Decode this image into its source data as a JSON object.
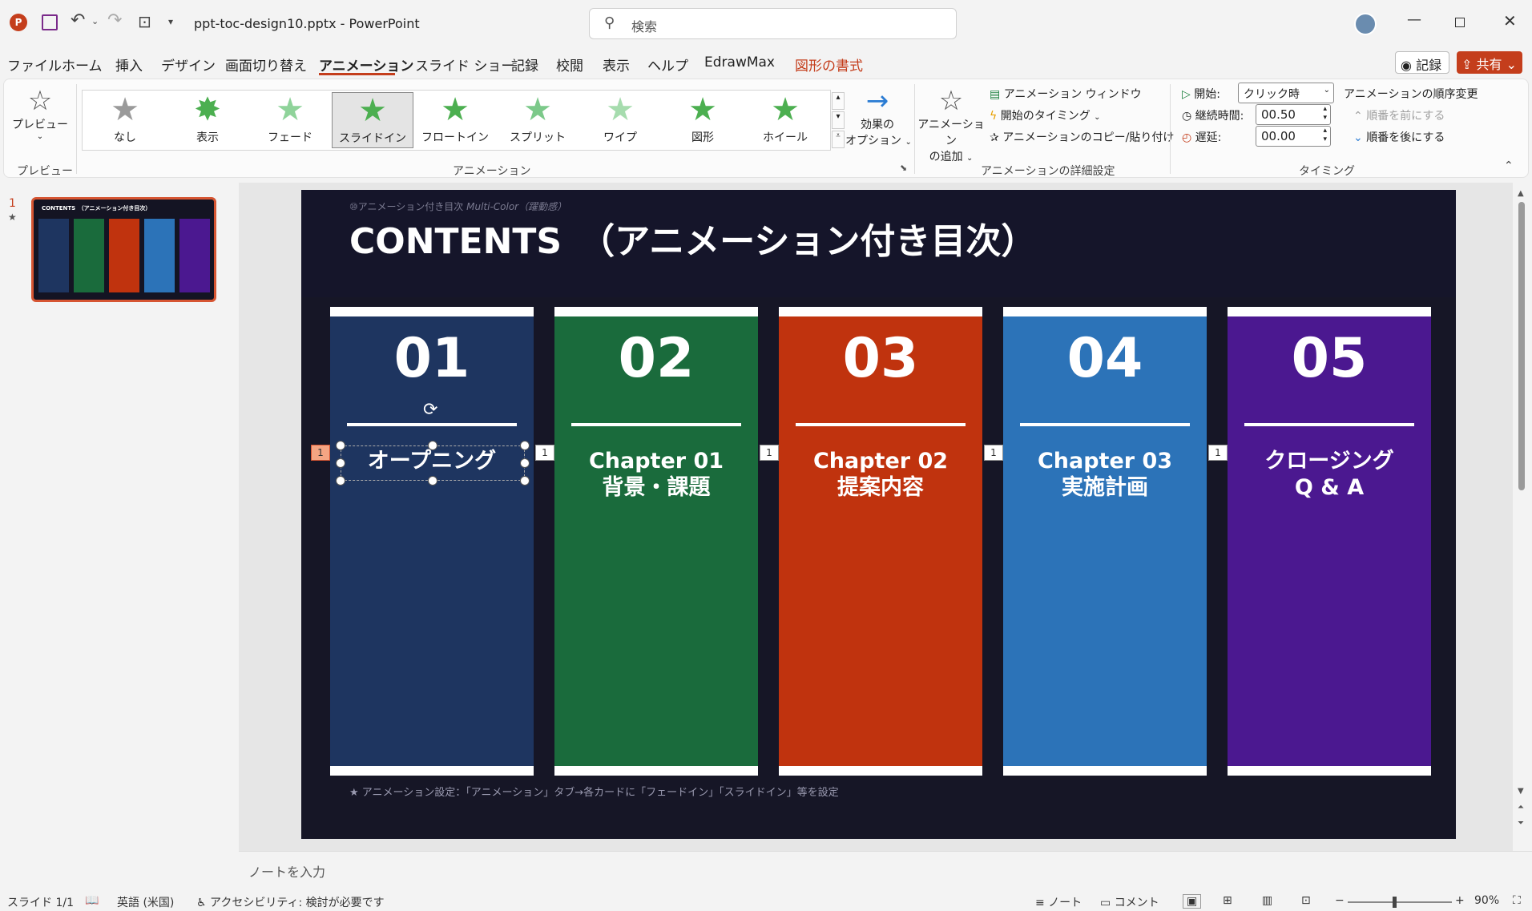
{
  "app": {
    "filename": "ppt-toc-design10.pptx",
    "separator": "-",
    "app_name": "PowerPoint",
    "search_placeholder": "検索"
  },
  "title_buttons": {
    "record": "記録",
    "share": "共有"
  },
  "tabs": [
    "ファイル",
    "ホーム",
    "挿入",
    "デザイン",
    "画面切り替え",
    "アニメーション",
    "スライド ショー",
    "記録",
    "校閲",
    "表示",
    "ヘルプ",
    "EdrawMax",
    "図形の書式"
  ],
  "active_tab": "アニメーション",
  "ribbon": {
    "preview": {
      "button": "プレビュー",
      "group": "プレビュー"
    },
    "animation_group": "アニメーション",
    "gallery": [
      "なし",
      "表示",
      "フェード",
      "スライドイン",
      "フロートイン",
      "スプリット",
      "ワイプ",
      "図形",
      "ホイール"
    ],
    "gallery_selected": "スライドイン",
    "effect_options": [
      "効果の",
      "オプション"
    ],
    "advanced": {
      "add": [
        "アニメーション",
        "の追加"
      ],
      "window": "アニメーション ウィンドウ",
      "trigger": "開始のタイミング",
      "painter": "アニメーションのコピー/貼り付け",
      "group": "アニメーションの詳細設定"
    },
    "timing": {
      "start_label": "開始:",
      "start_value": "クリック時",
      "duration_label": "継続時間:",
      "duration_value": "00.50",
      "delay_label": "遅延:",
      "delay_value": "00.00",
      "reorder": "アニメーションの順序変更",
      "move_earlier": "順番を前にする",
      "move_later": "順番を後にする",
      "group": "タイミング"
    }
  },
  "thumbnail": {
    "number": "1",
    "star": "★"
  },
  "slide": {
    "subtitle_jp": "⑩アニメーション付き目次",
    "subtitle_en": "Multi-Color（躍動感）",
    "title": "CONTENTS　（アニメーション付き目次）",
    "cards": [
      {
        "num": "01",
        "title": "オープニング",
        "color": "#1e3560"
      },
      {
        "num": "02",
        "title": "Chapter 01\n背景・課題",
        "color": "#1a6b3c"
      },
      {
        "num": "03",
        "title": "Chapter 02\n提案内容",
        "color": "#c0330e"
      },
      {
        "num": "04",
        "title": "Chapter 03\n実施計画",
        "color": "#2c73b8"
      },
      {
        "num": "05",
        "title": "クロージング\nQ & A",
        "color": "#4b1890"
      }
    ],
    "markers": [
      "1",
      "1",
      "1",
      "1",
      "1"
    ],
    "footnote": "★ アニメーション設定：「アニメーション」タブ→各カードに「フェードイン」「スライドイン」等を設定"
  },
  "notes_placeholder": "ノートを入力",
  "status": {
    "slide": "スライド 1/1",
    "language": "英語 (米国)",
    "accessibility": "アクセシビリティ: 検討が必要です",
    "notes": "ノート",
    "comments": "コメント",
    "zoom": "90%"
  }
}
